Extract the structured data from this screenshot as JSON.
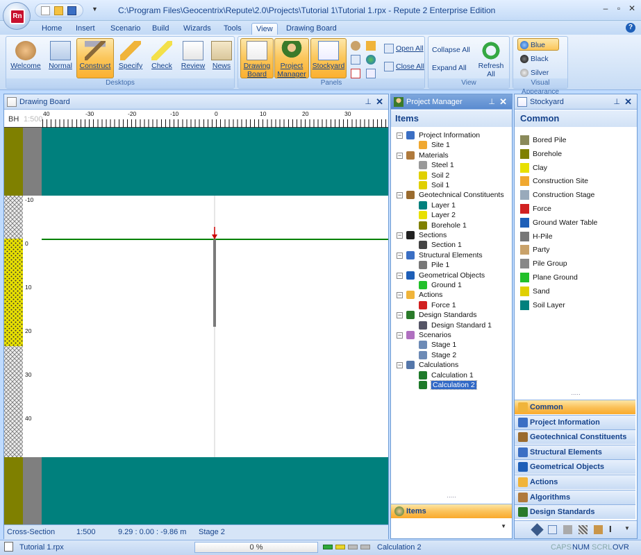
{
  "window": {
    "title": "C:\\Program Files\\Geocentrix\\Repute\\2.0\\Projects\\Tutorial 1\\Tutorial 1.rpx - Repute 2 Enterprise Edition",
    "logo_text": "Rn"
  },
  "ribbon_tabs": [
    "Home",
    "Insert",
    "Scenario",
    "Build",
    "Wizards",
    "Tools",
    "View",
    "Drawing Board"
  ],
  "active_tab": "View",
  "groups": {
    "desktops": {
      "label": "Desktops",
      "buttons": [
        "Welcome",
        "Normal",
        "Construct",
        "Specify",
        "Check",
        "Review",
        "News"
      ]
    },
    "panels": {
      "label": "Panels",
      "buttons": [
        "Drawing Board",
        "Project Manager",
        "Stockyard"
      ],
      "small_buttons": [
        "Open All",
        "Close All"
      ]
    },
    "view": {
      "label": "View",
      "buttons": [
        "Collapse All",
        "Expand All",
        "Refresh All"
      ]
    },
    "appearance": {
      "label": "Visual Appearance",
      "options": [
        "Blue",
        "Black",
        "Silver"
      ],
      "selected": "Blue"
    }
  },
  "drawing_board": {
    "title": "Drawing Board",
    "bh_label": "BH",
    "scale_label": "1:500",
    "ruler_labels": [
      "40",
      "-30",
      "-20",
      "-10",
      "0",
      "10",
      "20",
      "30"
    ],
    "depth_labels": [
      "-10",
      "0",
      "10",
      "20",
      "30",
      "40"
    ],
    "colors": {
      "teal": "#00807d",
      "olive": "#7f8000",
      "grey": "#7f7f7f",
      "green_line": "#008000"
    },
    "status": {
      "view": "Cross-Section",
      "scale": "1:500",
      "coords": "9.29 : 0.00 : -9.86 m",
      "stage": "Stage 2"
    }
  },
  "project_manager": {
    "title": "Project Manager",
    "header": "Items",
    "tree": [
      {
        "label": "Project Information",
        "level": 0,
        "icon": "info-icon"
      },
      {
        "label": "Site 1",
        "level": 1,
        "icon": "site-icon"
      },
      {
        "label": "Materials",
        "level": 0,
        "icon": "materials-icon"
      },
      {
        "label": "Steel 1",
        "level": 1,
        "icon": "steel-icon"
      },
      {
        "label": "Soil 2",
        "level": 1,
        "icon": "soil-icon"
      },
      {
        "label": "Soil 1",
        "level": 1,
        "icon": "soil-icon"
      },
      {
        "label": "Geotechnical Constituents",
        "level": 0,
        "icon": "geotech-icon"
      },
      {
        "label": "Layer 1",
        "level": 1,
        "icon": "layer-teal-icon"
      },
      {
        "label": "Layer 2",
        "level": 1,
        "icon": "layer-sand-icon"
      },
      {
        "label": "Borehole 1",
        "level": 1,
        "icon": "borehole-icon"
      },
      {
        "label": "Sections",
        "level": 0,
        "icon": "sections-icon"
      },
      {
        "label": "Section 1",
        "level": 1,
        "icon": "section-icon"
      },
      {
        "label": "Structural Elements",
        "level": 0,
        "icon": "structural-icon"
      },
      {
        "label": "Pile 1",
        "level": 1,
        "icon": "pile-icon"
      },
      {
        "label": "Geometrical Objects",
        "level": 0,
        "icon": "geometry-icon"
      },
      {
        "label": "Ground 1",
        "level": 1,
        "icon": "ground-icon"
      },
      {
        "label": "Actions",
        "level": 0,
        "icon": "actions-icon"
      },
      {
        "label": "Force 1",
        "level": 1,
        "icon": "force-icon"
      },
      {
        "label": "Design Standards",
        "level": 0,
        "icon": "standards-icon"
      },
      {
        "label": "Design Standard 1",
        "level": 1,
        "icon": "standard-icon"
      },
      {
        "label": "Scenarios",
        "level": 0,
        "icon": "scenarios-icon"
      },
      {
        "label": "Stage 1",
        "level": 1,
        "icon": "stage-icon"
      },
      {
        "label": "Stage 2",
        "level": 1,
        "icon": "stage-icon"
      },
      {
        "label": "Calculations",
        "level": 0,
        "icon": "calculations-icon"
      },
      {
        "label": "Calculation 1",
        "level": 1,
        "icon": "calc-icon"
      },
      {
        "label": "Calculation 2",
        "level": 1,
        "icon": "calc-icon",
        "selected": true
      }
    ],
    "footer_button": "Items"
  },
  "stockyard": {
    "title": "Stockyard",
    "header": "Common",
    "items": [
      "Bored Pile",
      "Borehole",
      "Clay",
      "Construction Site",
      "Construction Stage",
      "Force",
      "Ground Water Table",
      "H-Pile",
      "Party",
      "Pile Group",
      "Plane Ground",
      "Sand",
      "Soil Layer"
    ],
    "nav": [
      "Common",
      "Project Information",
      "Geotechnical Constituents",
      "Structural Elements",
      "Geometrical Objects",
      "Actions",
      "Algorithms",
      "Design Standards"
    ],
    "nav_selected": "Common"
  },
  "statusbar": {
    "file": "Tutorial 1.rpx",
    "progress": "0 %",
    "calc": "Calculation 2",
    "caps": "CAPS",
    "num": "NUM",
    "scrl": "SCRL",
    "ovr": "OVR"
  }
}
